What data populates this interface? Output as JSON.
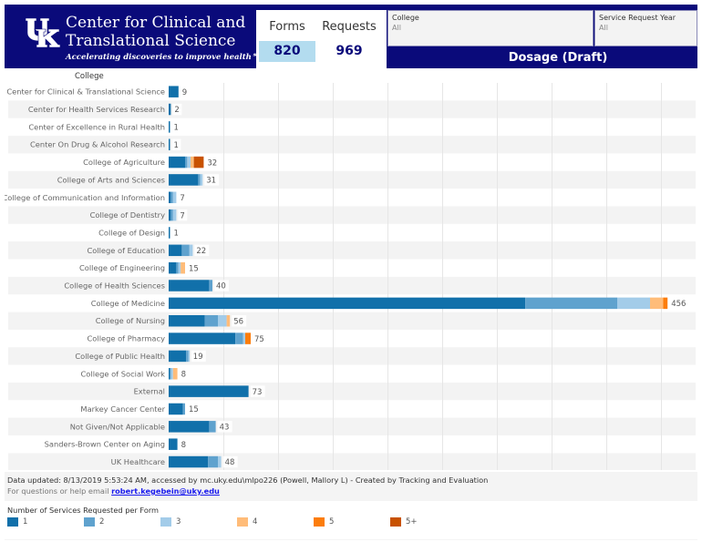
{
  "header": {
    "brand_line1": "Center for Clinical and",
    "brand_line2": "Translational Science",
    "tagline": "Accelerating discoveries to improve health℠",
    "logo": "uk-logo-icon",
    "kpis": [
      {
        "label": "Forms",
        "value": "820"
      },
      {
        "label": "Requests",
        "value": "969"
      }
    ],
    "filters": [
      {
        "label": "College",
        "value": "All"
      },
      {
        "label": "Service Request Year",
        "value": "All"
      }
    ],
    "dashboard_title": "Dosage (Draft)"
  },
  "chart_data": {
    "type": "bar",
    "orientation": "horizontal",
    "stacked": true,
    "title": "Dosage (Draft)",
    "row_header": "College",
    "xlabel": "",
    "ylabel": "College",
    "xlim": [
      0,
      480
    ],
    "grid": true,
    "legend_title": "Number of Services Requested per Form",
    "legend_position": "bottom",
    "series_names": [
      "1",
      "2",
      "3",
      "4",
      "5",
      "5+"
    ],
    "colors": [
      "#1170aa",
      "#5fa2ce",
      "#a3cce9",
      "#ffbc79",
      "#fc7d0b",
      "#c85200"
    ],
    "categories": [
      "Center for Clinical & Translational Science",
      "Center for Health Services Research",
      "Center of Excellence in Rural Health",
      "Center On Drug & Alcohol Research",
      "College of Agriculture",
      "College of Arts and Sciences",
      "College of Communication and Information",
      "College of Dentistry",
      "College of Design",
      "College of Education",
      "College of Engineering",
      "College of Health Sciences",
      "College of Medicine",
      "College of Nursing",
      "College of Pharmacy",
      "College of Public Health",
      "College of Social Work",
      "External",
      "Markey Cancer Center",
      "Not Given/Not Applicable",
      "Sanders-Brown Center on Aging",
      "UK Healthcare"
    ],
    "series": [
      {
        "name": "1",
        "values": [
          9,
          2,
          1,
          1,
          15,
          27,
          2,
          2,
          1,
          12,
          7,
          37,
          326,
          33,
          61,
          16,
          1,
          73,
          13,
          37,
          8,
          36
        ]
      },
      {
        "name": "2",
        "values": [
          0,
          0,
          0,
          0,
          2,
          2,
          2,
          2,
          0,
          7,
          2,
          3,
          84,
          12,
          7,
          2,
          1,
          0,
          2,
          6,
          0,
          9
        ]
      },
      {
        "name": "3",
        "values": [
          0,
          0,
          0,
          0,
          3,
          2,
          3,
          3,
          0,
          3,
          2,
          0,
          30,
          8,
          2,
          1,
          2,
          0,
          0,
          0,
          0,
          3
        ]
      },
      {
        "name": "4",
        "values": [
          0,
          0,
          0,
          0,
          3,
          0,
          0,
          0,
          0,
          0,
          4,
          0,
          12,
          3,
          0,
          0,
          4,
          0,
          0,
          0,
          0,
          0
        ]
      },
      {
        "name": "5",
        "values": [
          0,
          0,
          0,
          0,
          0,
          0,
          0,
          0,
          0,
          0,
          0,
          0,
          4,
          0,
          5,
          0,
          0,
          0,
          0,
          0,
          0,
          0
        ]
      },
      {
        "name": "5+",
        "values": [
          0,
          0,
          0,
          0,
          9,
          0,
          0,
          0,
          0,
          0,
          0,
          0,
          0,
          0,
          0,
          0,
          0,
          0,
          0,
          0,
          0,
          0
        ]
      }
    ],
    "totals": [
      9,
      2,
      1,
      1,
      32,
      31,
      7,
      7,
      1,
      22,
      15,
      40,
      456,
      56,
      75,
      19,
      8,
      73,
      15,
      43,
      8,
      48
    ]
  },
  "footer": {
    "updated_text": "Data updated: 8/13/2019 5:53:24 AM, accessed by mc.uky.edu\\mlpo226 (Powell, Mallory L) - Created by Tracking and Evaluation",
    "help_prefix": "For questions or help email ",
    "help_email": "robert.kegebein@uky.edu"
  },
  "legend": {
    "title": "Number of Services Requested per Form",
    "items": [
      {
        "label": "1",
        "color": "#1170aa"
      },
      {
        "label": "2",
        "color": "#5fa2ce"
      },
      {
        "label": "3",
        "color": "#a3cce9"
      },
      {
        "label": "4",
        "color": "#ffbc79"
      },
      {
        "label": "5",
        "color": "#fc7d0b"
      },
      {
        "label": "5+",
        "color": "#c85200"
      }
    ]
  }
}
